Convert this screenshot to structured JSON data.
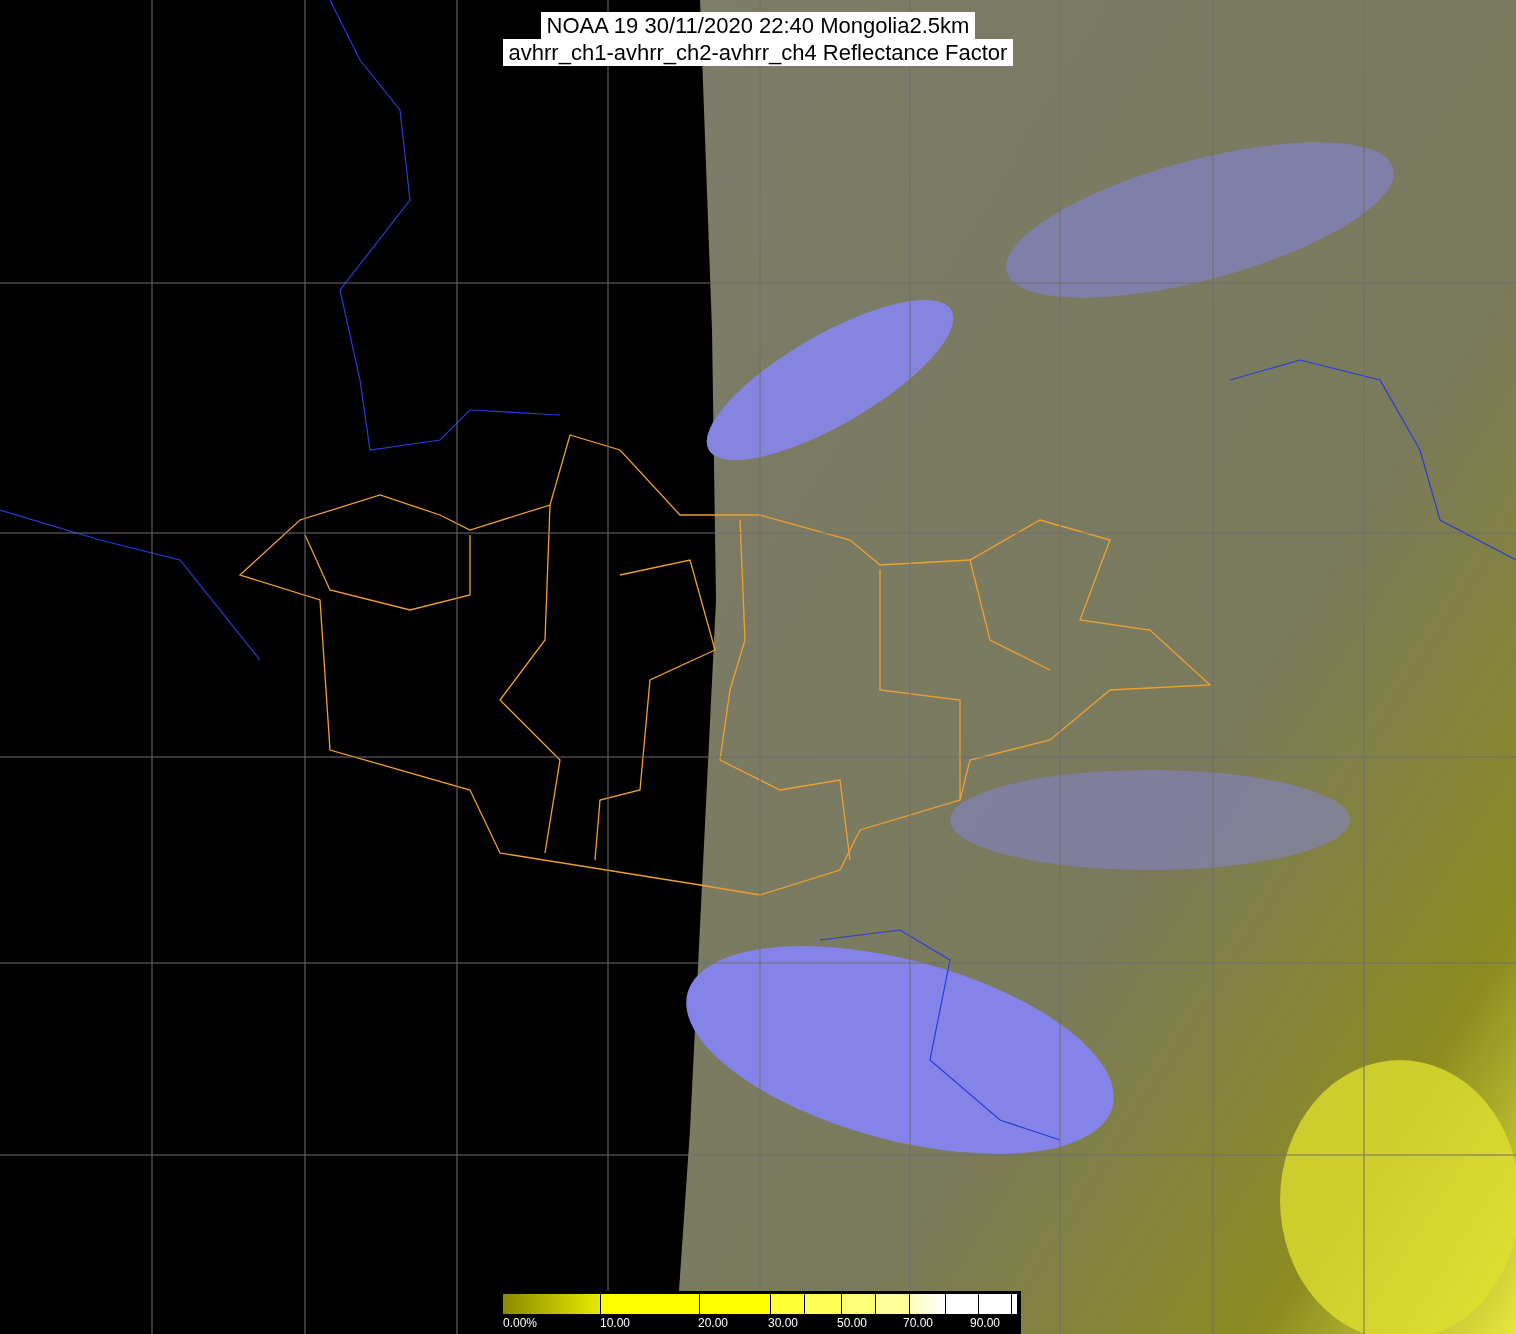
{
  "title": {
    "lines": [
      "NOAA 19 30/11/2020 22:40 Mongolia2.5km",
      "avhrr_ch1-avhrr_ch2-avhrr_ch4 Reflectance Factor"
    ]
  },
  "colorbar": {
    "labels": [
      "0.00%",
      "10.00",
      "20.00",
      "30.00",
      "50.00",
      "70.00",
      "90.00"
    ]
  }
}
